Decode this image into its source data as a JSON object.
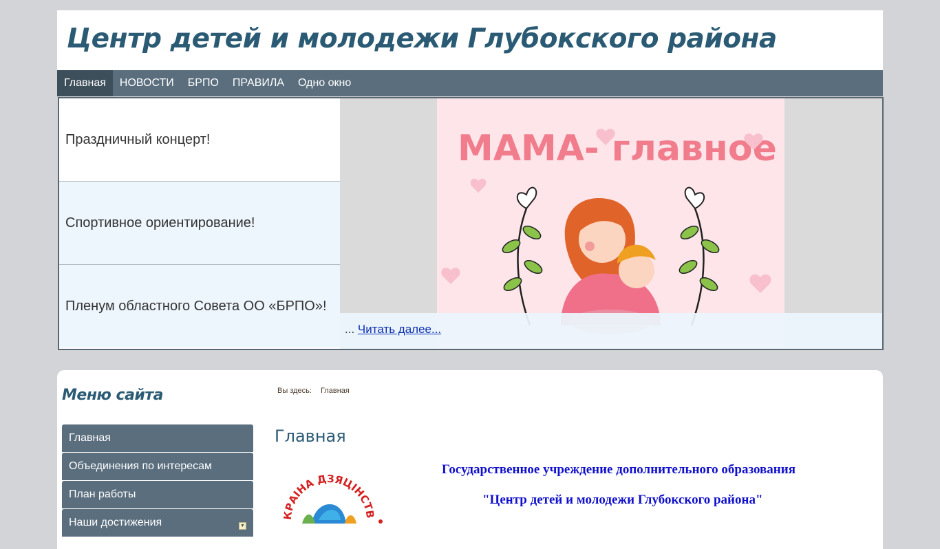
{
  "header": {
    "title": "Центр детей и молодежи Глубокского района"
  },
  "topnav": {
    "items": [
      {
        "label": "Главная",
        "active": true
      },
      {
        "label": "НОВОСТИ",
        "active": false
      },
      {
        "label": "БРПО",
        "active": false
      },
      {
        "label": "ПРАВИЛА",
        "active": false
      },
      {
        "label": "Одно окно",
        "active": false
      }
    ]
  },
  "slider": {
    "news": [
      {
        "title": "Праздничный концерт!"
      },
      {
        "title": "Спортивное ориентирование!"
      },
      {
        "title": "Пленум областного Совета ОО «БРПО»!"
      }
    ],
    "image_text": "МАМА- главное слово",
    "ellipsis": "...",
    "read_more": "Читать далее..."
  },
  "sidebar": {
    "title": "Меню сайта",
    "items": [
      {
        "label": "Главная"
      },
      {
        "label": "Объединения по интересам"
      },
      {
        "label": "План работы"
      },
      {
        "label": "Наши достижения"
      }
    ]
  },
  "main": {
    "breadcrumb_label": "Вы здесь:",
    "breadcrumb_current": "Главная",
    "page_title": "Главная",
    "org_line1": "Государственное учреждение дополнительного образования",
    "org_line2": "\"Центр детей и молодежи Глубокского района\"",
    "logo_text": "КРАІНА ДЗЯЦІНСТВА"
  },
  "colors": {
    "nav_bg": "#5a6e7e",
    "nav_active": "#3e4f5c",
    "title": "#2b5b74",
    "org_text": "#1010cc",
    "slide_bg": "#fde5ea",
    "slide_text": "#f07c8c"
  }
}
